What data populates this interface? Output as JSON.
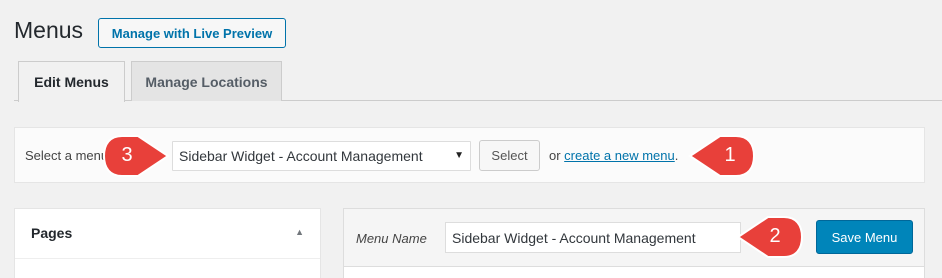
{
  "page": {
    "title": "Menus",
    "live_preview_button": "Manage with Live Preview"
  },
  "tabs": [
    {
      "label": "Edit Menus",
      "active": true
    },
    {
      "label": "Manage Locations",
      "active": false
    }
  ],
  "select_bar": {
    "label": "Select a menu",
    "selected_menu": "Sidebar Widget - Account Management",
    "select_button": "Select",
    "or_text": "or ",
    "create_link": "create a new menu",
    "period": "."
  },
  "pages_box": {
    "title": "Pages"
  },
  "menu_editor": {
    "name_label": "Menu Name",
    "name_value": "Sidebar Widget - Account Management",
    "save_button": "Save Menu"
  },
  "callouts": [
    {
      "number": "1",
      "color": "#e8403a"
    },
    {
      "number": "2",
      "color": "#e8403a"
    },
    {
      "number": "3",
      "color": "#e8403a"
    }
  ]
}
